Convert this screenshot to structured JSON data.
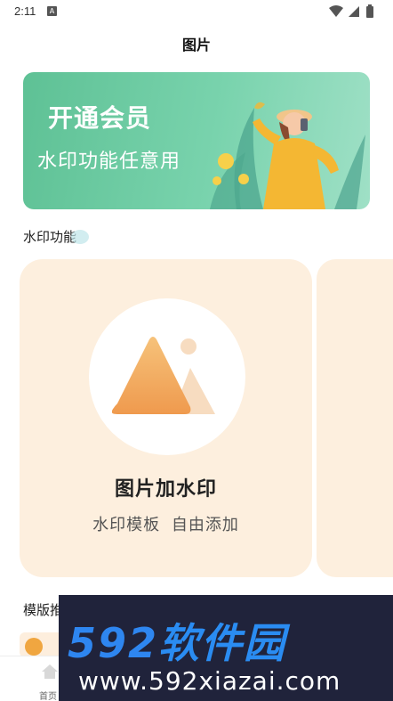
{
  "status_bar": {
    "time": "2:11",
    "notification_badge": "A"
  },
  "header": {
    "title": "图片"
  },
  "vip_banner": {
    "title": "开通会员",
    "subtitle": "水印功能任意用"
  },
  "sections": {
    "watermark_title": "水印功能",
    "template_title": "模版推"
  },
  "feature_card": {
    "title": "图片加水印",
    "subtitle": "水印模板 自由添加"
  },
  "bottom_nav": {
    "home_label": "首页"
  },
  "ad_overlay": {
    "brand_num": "592",
    "brand_text": "软件园",
    "url": "www.592xiazai.com"
  },
  "colors": {
    "banner_green": "#5ec195",
    "card_bg": "#fdefde",
    "icon_orange": "#f3a35a",
    "ad_bg": "#20233b",
    "ad_blue": "#2a8cf2"
  }
}
